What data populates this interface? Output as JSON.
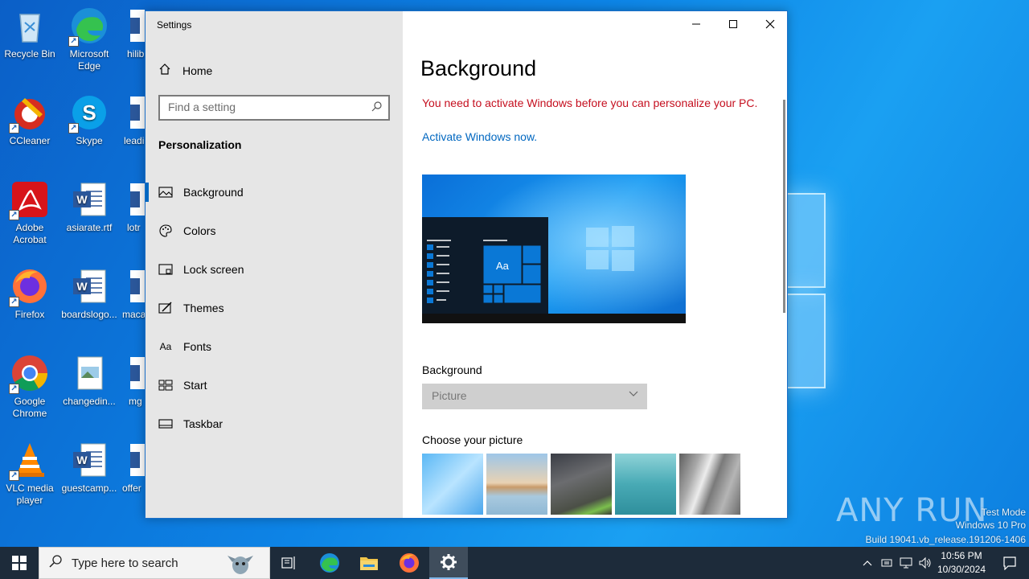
{
  "desktop": {
    "icons": [
      {
        "label": "Recycle Bin"
      },
      {
        "label": "Microsoft Edge"
      },
      {
        "label": "CCleaner"
      },
      {
        "label": "Skype"
      },
      {
        "label": "Adobe Acrobat"
      },
      {
        "label": "asiarate.rtf"
      },
      {
        "label": "Firefox"
      },
      {
        "label": "boardslogo..."
      },
      {
        "label": "Google Chrome"
      },
      {
        "label": "changedin..."
      },
      {
        "label": "VLC media player"
      },
      {
        "label": "guestcamp..."
      },
      {
        "label": "hilib"
      },
      {
        "label": "leadi"
      },
      {
        "label": "lotr"
      },
      {
        "label": "maca"
      },
      {
        "label": "mg"
      },
      {
        "label": "offer"
      }
    ]
  },
  "window": {
    "title": "Settings",
    "home_label": "Home",
    "search_placeholder": "Find a setting",
    "section_title": "Personalization",
    "nav": [
      {
        "label": "Background",
        "icon": "picture-icon"
      },
      {
        "label": "Colors",
        "icon": "palette-icon"
      },
      {
        "label": "Lock screen",
        "icon": "lock-screen-icon"
      },
      {
        "label": "Themes",
        "icon": "brush-icon"
      },
      {
        "label": "Fonts",
        "icon": "font-icon"
      },
      {
        "label": "Start",
        "icon": "start-icon"
      },
      {
        "label": "Taskbar",
        "icon": "taskbar-icon"
      }
    ],
    "active_nav": "Background"
  },
  "content": {
    "heading": "Background",
    "warning": "You need to activate Windows before you can personalize your PC.",
    "activate_link": "Activate Windows now.",
    "preview_tile_text": "Aa",
    "background_label": "Background",
    "background_value": "Picture",
    "choose_label": "Choose your picture"
  },
  "taskbar": {
    "search_placeholder": "Type here to search",
    "time": "10:56 PM",
    "date": "10/30/2024"
  },
  "watermark": {
    "brand": "ANY RUN",
    "line1": "Test Mode",
    "line2": "Windows 10 Pro",
    "line3": "Build 19041.vb_release.191206-1406"
  },
  "colors": {
    "accent": "#0067c0",
    "warning": "#c50f1f"
  }
}
